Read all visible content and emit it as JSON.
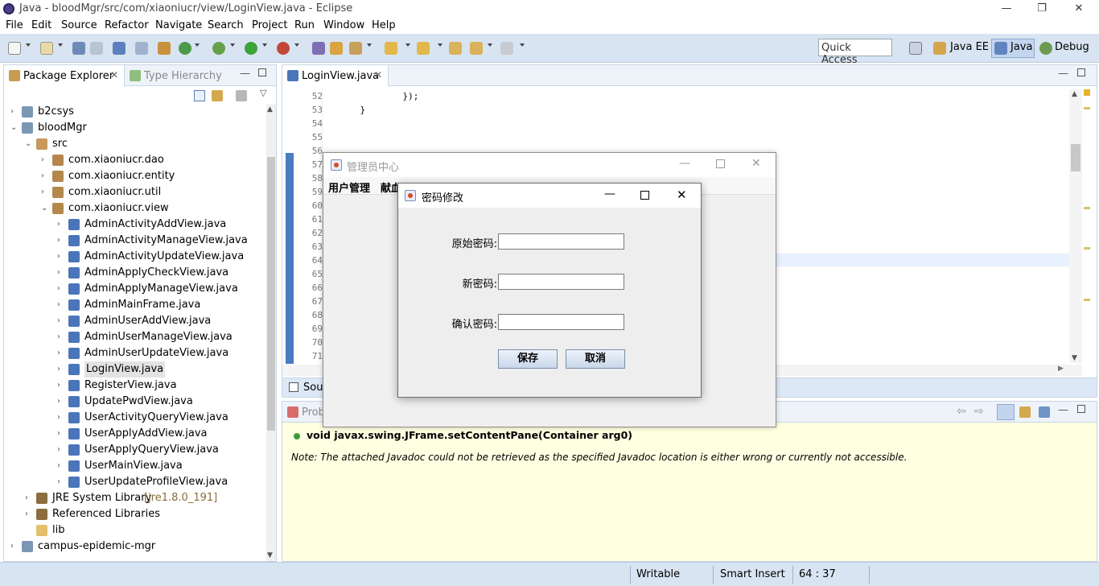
{
  "window": {
    "title": "Java - bloodMgr/src/com/xiaoniucr/view/LoginView.java - Eclipse",
    "minimize": "—",
    "restore": "❐",
    "close": "✕"
  },
  "menu": [
    "File",
    "Edit",
    "Source",
    "Refactor",
    "Navigate",
    "Search",
    "Project",
    "Run",
    "Window",
    "Help"
  ],
  "toolbar": {
    "quick_access": "Quick Access",
    "perspectives": [
      "Java EE",
      "Java",
      "Debug"
    ]
  },
  "package_explorer": {
    "tab_active": "Package Explorer",
    "tab_other": "Type Hierarchy",
    "tree": [
      {
        "label": "b2csys",
        "depth": 0,
        "toggle": "›",
        "icon": "project-icon"
      },
      {
        "label": "bloodMgr",
        "depth": 0,
        "toggle": "⌄",
        "icon": "project-icon"
      },
      {
        "label": "src",
        "depth": 1,
        "toggle": "⌄",
        "icon": "source-folder-icon"
      },
      {
        "label": "com.xiaoniucr.dao",
        "depth": 2,
        "toggle": "›",
        "icon": "package-icon"
      },
      {
        "label": "com.xiaoniucr.entity",
        "depth": 2,
        "toggle": "›",
        "icon": "package-icon"
      },
      {
        "label": "com.xiaoniucr.util",
        "depth": 2,
        "toggle": "›",
        "icon": "package-icon"
      },
      {
        "label": "com.xiaoniucr.view",
        "depth": 2,
        "toggle": "⌄",
        "icon": "package-icon"
      },
      {
        "label": "AdminActivityAddView.java",
        "depth": 3,
        "toggle": "›",
        "icon": "java-file-icon"
      },
      {
        "label": "AdminActivityManageView.java",
        "depth": 3,
        "toggle": "›",
        "icon": "java-file-icon"
      },
      {
        "label": "AdminActivityUpdateView.java",
        "depth": 3,
        "toggle": "›",
        "icon": "java-file-icon"
      },
      {
        "label": "AdminApplyCheckView.java",
        "depth": 3,
        "toggle": "›",
        "icon": "java-file-icon"
      },
      {
        "label": "AdminApplyManageView.java",
        "depth": 3,
        "toggle": "›",
        "icon": "java-file-icon"
      },
      {
        "label": "AdminMainFrame.java",
        "depth": 3,
        "toggle": "›",
        "icon": "java-file-icon"
      },
      {
        "label": "AdminUserAddView.java",
        "depth": 3,
        "toggle": "›",
        "icon": "java-file-icon"
      },
      {
        "label": "AdminUserManageView.java",
        "depth": 3,
        "toggle": "›",
        "icon": "java-file-icon"
      },
      {
        "label": "AdminUserUpdateView.java",
        "depth": 3,
        "toggle": "›",
        "icon": "java-file-icon"
      },
      {
        "label": "LoginView.java",
        "depth": 3,
        "toggle": "›",
        "icon": "java-file-icon",
        "selected": true
      },
      {
        "label": "RegisterView.java",
        "depth": 3,
        "toggle": "›",
        "icon": "java-file-icon"
      },
      {
        "label": "UpdatePwdView.java",
        "depth": 3,
        "toggle": "›",
        "icon": "java-file-icon"
      },
      {
        "label": "UserActivityQueryView.java",
        "depth": 3,
        "toggle": "›",
        "icon": "java-file-icon"
      },
      {
        "label": "UserApplyAddView.java",
        "depth": 3,
        "toggle": "›",
        "icon": "java-file-icon"
      },
      {
        "label": "UserApplyQueryView.java",
        "depth": 3,
        "toggle": "›",
        "icon": "java-file-icon"
      },
      {
        "label": "UserMainView.java",
        "depth": 3,
        "toggle": "›",
        "icon": "java-file-icon"
      },
      {
        "label": "UserUpdateProfileView.java",
        "depth": 3,
        "toggle": "›",
        "icon": "java-file-icon"
      },
      {
        "label": "JRE System Library",
        "suffix": "[jre1.8.0_191]",
        "depth": 1,
        "toggle": "›",
        "icon": "library-icon"
      },
      {
        "label": "Referenced Libraries",
        "depth": 1,
        "toggle": "›",
        "icon": "library-icon"
      },
      {
        "label": "lib",
        "depth": 1,
        "toggle": "",
        "icon": "folder-icon"
      },
      {
        "label": "campus-epidemic-mgr",
        "depth": 0,
        "toggle": "›",
        "icon": "project-icon"
      }
    ]
  },
  "editor": {
    "tab": "LoginView.java",
    "lines": [
      {
        "n": "52",
        "code": "            });"
      },
      {
        "n": "53",
        "code": "    }"
      },
      {
        "n": "54",
        "code": ""
      },
      {
        "n": "55",
        "code": ""
      },
      {
        "n": "56",
        "code": ""
      },
      {
        "n": "57",
        "code": ""
      },
      {
        "n": "58",
        "code": ""
      },
      {
        "n": "59",
        "code": ""
      },
      {
        "n": "60",
        "code": ""
      },
      {
        "n": "61",
        "code": ""
      },
      {
        "n": "62",
        "code": ""
      },
      {
        "n": "63",
        "code": ""
      },
      {
        "n": "64",
        "code": ""
      },
      {
        "n": "65",
        "code": ""
      },
      {
        "n": "66",
        "code": ""
      },
      {
        "n": "67",
        "code": ""
      },
      {
        "n": "68",
        "code": ""
      },
      {
        "n": "69",
        "code": ""
      },
      {
        "n": "70",
        "code": ""
      },
      {
        "n": "71",
        "code": ""
      }
    ],
    "bottom_tab": "Sour"
  },
  "javadoc": {
    "tab": "Prob",
    "signature": "void javax.swing.JFrame.setContentPane(Container arg0)",
    "note": "Note: The attached Javadoc could not be retrieved as the specified Javadoc location is either wrong or currently not accessible."
  },
  "statusbar": {
    "writable": "Writable",
    "insert_mode": "Smart Insert",
    "position": "64 : 37"
  },
  "admin_window": {
    "title": "管理员中心",
    "menus": [
      "用户管理",
      "献血"
    ]
  },
  "password_dialog": {
    "title": "密码修改",
    "fields": [
      {
        "label": "原始密码:",
        "value": ""
      },
      {
        "label": "新密码:",
        "value": ""
      },
      {
        "label": "确认密码:",
        "value": ""
      }
    ],
    "save": "保存",
    "cancel": "取消"
  }
}
